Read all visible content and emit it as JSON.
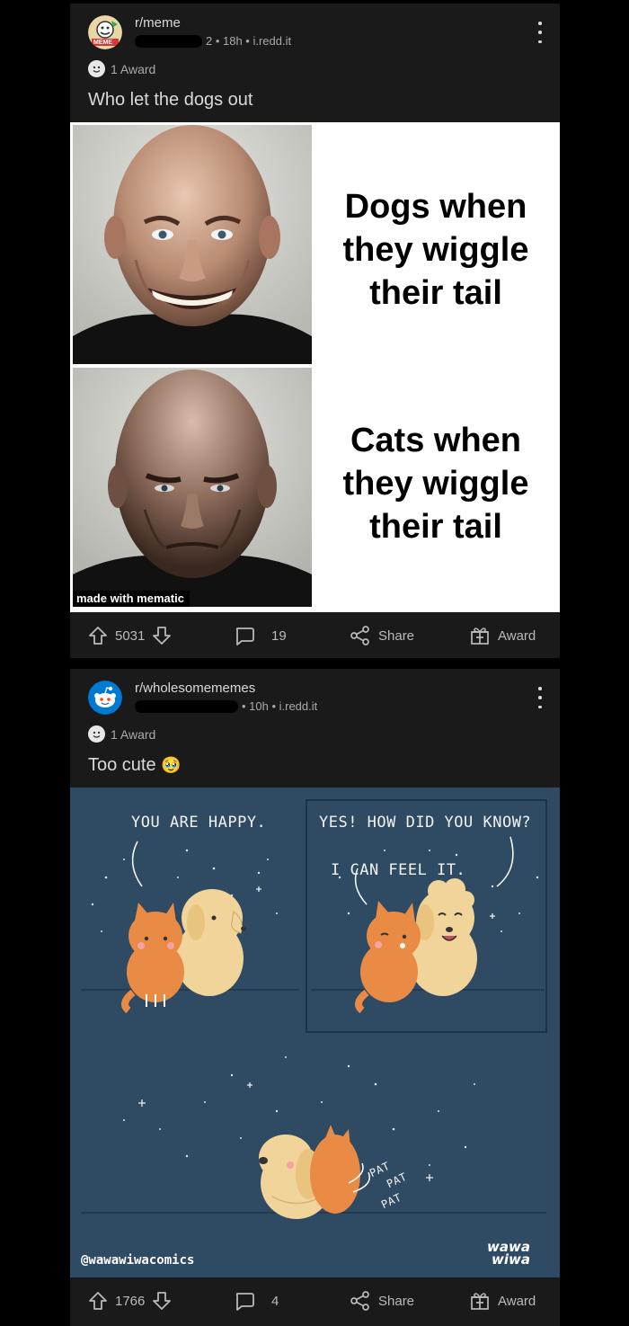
{
  "posts": [
    {
      "subreddit": "r/meme",
      "meta_suffix": "2 • 18h • i.redd.it",
      "award_label": "1 Award",
      "title": "Who let the dogs out",
      "meme": {
        "top_text": "Dogs when they wiggle their tail",
        "bottom_text": "Cats when they wiggle their tail",
        "watermark": "made with mematic",
        "avatar_badge": "MEME"
      },
      "votes": "5031",
      "comments": "19",
      "share_label": "Share",
      "award_button_label": "Award"
    },
    {
      "subreddit": "r/wholesomememes",
      "meta_suffix": "• 10h • i.redd.it",
      "award_label": "1 Award",
      "title": "Too cute",
      "title_emoji": "🥹",
      "comic": {
        "speech_1": "YOU ARE HAPPY.",
        "speech_2": "YES! HOW DID YOU KNOW?",
        "speech_3": "I CAN FEEL IT.",
        "pat_1": "PAT",
        "pat_2": "PAT",
        "pat_3": "PAT",
        "credit": "@wawawiwacomics",
        "logo_line_1": "wawa",
        "logo_line_2": "wiwa"
      },
      "votes": "1766",
      "comments": "4",
      "share_label": "Share",
      "award_button_label": "Award"
    }
  ],
  "colors": {
    "background": "#000000",
    "card": "#1a1a1b",
    "text": "#d7dadc",
    "meta_text": "#a8aaab",
    "comic_bg": "#2f4a63",
    "reddit_blue": "#0079d3"
  },
  "icons": [
    "more-vert-icon",
    "award-icon",
    "upvote-icon",
    "downvote-icon",
    "comment-icon",
    "share-icon",
    "gift-icon",
    "snoo-icon"
  ]
}
